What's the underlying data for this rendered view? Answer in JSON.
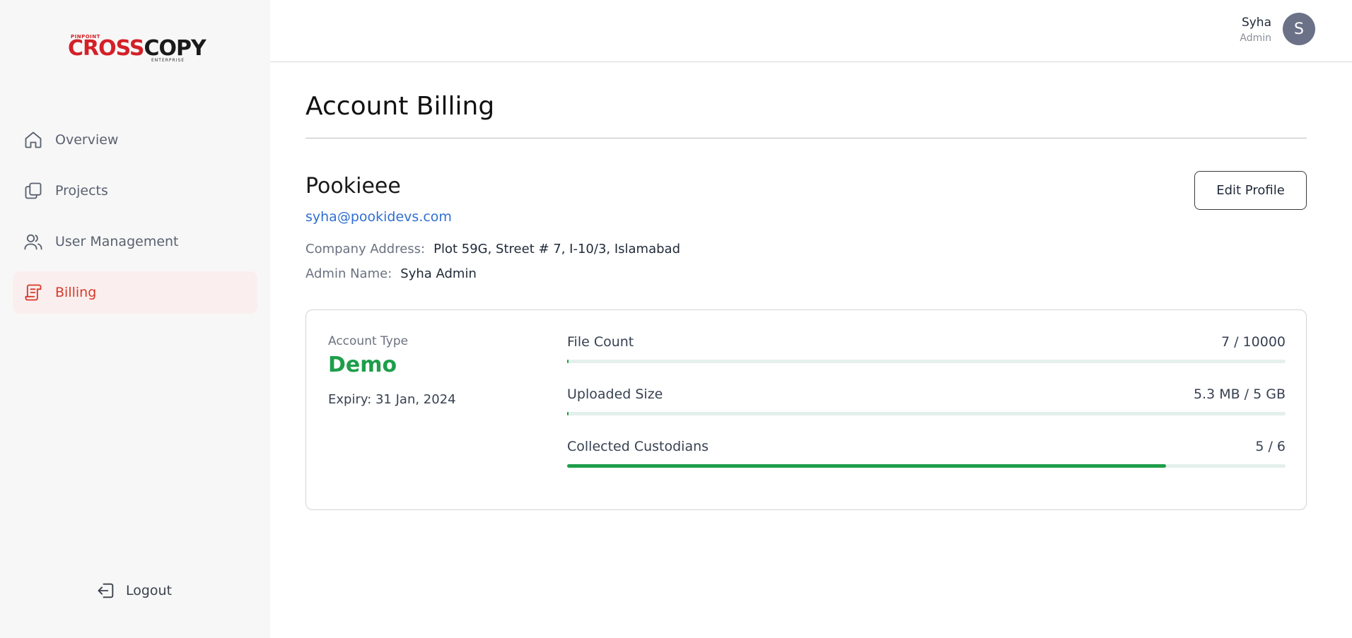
{
  "brand": {
    "logo_top": "PINPOINT",
    "logo_cross": "CROSS",
    "logo_copy": "COPY",
    "logo_sub": "ENTERPRISE",
    "accent_color": "#d63a2b",
    "success_color": "#1e9e4a",
    "link_color": "#2f6fd1"
  },
  "sidebar": {
    "items": [
      {
        "label": "Overview",
        "icon": "home-icon",
        "active": false
      },
      {
        "label": "Projects",
        "icon": "projects-icon",
        "active": false
      },
      {
        "label": "User Management",
        "icon": "users-icon",
        "active": false
      },
      {
        "label": "Billing",
        "icon": "billing-icon",
        "active": true
      }
    ],
    "logout_label": "Logout"
  },
  "header": {
    "user_name": "Syha",
    "user_role": "Admin",
    "avatar_initial": "S"
  },
  "main": {
    "title": "Account Billing",
    "org_name": "Pookieee",
    "email": "syha@pookidevs.com",
    "company_address_label": "Company Address:",
    "company_address": "Plot 59G, Street # 7, I-10/3, Islamabad",
    "admin_name_label": "Admin Name:",
    "admin_name": "Syha Admin",
    "edit_profile_label": "Edit Profile"
  },
  "plan": {
    "account_type_label": "Account Type",
    "account_type": "Demo",
    "expiry": "Expiry: 31 Jan, 2024",
    "metrics": [
      {
        "label": "File Count",
        "value": "7 / 10000",
        "progress": 0.0007
      },
      {
        "label": "Uploaded Size",
        "value": "5.3 MB / 5 GB",
        "progress": 0.001
      },
      {
        "label": "Collected Custodians",
        "value": "5 / 6",
        "progress": 0.8333
      }
    ]
  }
}
